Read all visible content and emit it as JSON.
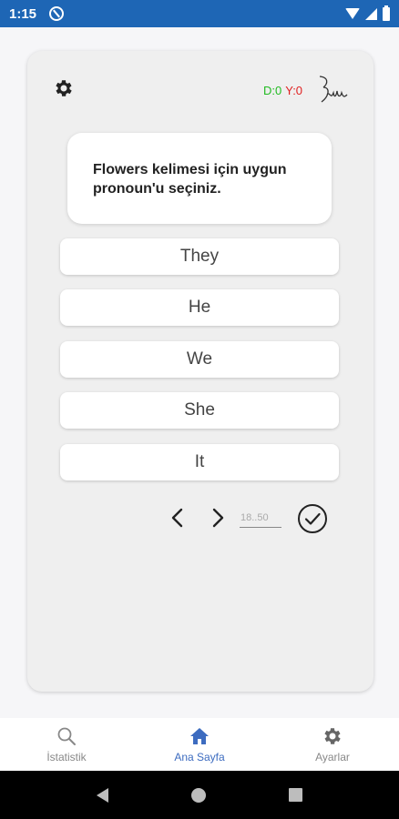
{
  "status_bar": {
    "time": "1:15"
  },
  "header": {
    "settings_icon": "gear-icon",
    "score": {
      "correct": "D:0",
      "wrong": "Y:0",
      "correct_color": "#22bb22",
      "wrong_color": "#e02020"
    }
  },
  "question": {
    "text": "Flowers kelimesi için uygun pronoun'u seçiniz."
  },
  "options": [
    "They",
    "He",
    "We",
    "She",
    "It"
  ],
  "navigation": {
    "prev_icon": "chevron-left-icon",
    "next_icon": "chevron-right-icon",
    "page_placeholder": "18..50",
    "submit_icon": "check-circle-icon"
  },
  "bottom_nav": {
    "items": [
      {
        "label": "İstatistik",
        "icon": "search-icon",
        "active": false
      },
      {
        "label": "Ana Sayfa",
        "icon": "home-icon",
        "active": true
      },
      {
        "label": "Ayarlar",
        "icon": "gear-icon",
        "active": false
      }
    ],
    "active_color": "#3d6cc0"
  },
  "colors": {
    "status_bar": "#1e66b5",
    "background": "#f6f6f8",
    "card": "#efefef"
  }
}
